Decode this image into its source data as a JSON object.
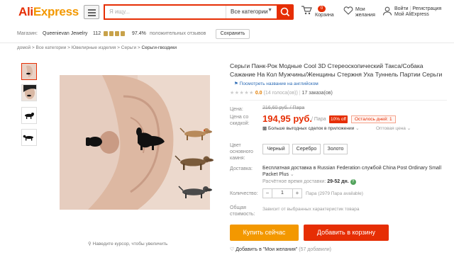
{
  "header": {
    "logo_main": "Ali",
    "logo_accent": "Express",
    "search_placeholder": "Я ищу...",
    "search_category": "Все категории",
    "cart_label": "Корзина",
    "cart_count": "0",
    "wishlist_label_1": "Мои",
    "wishlist_label_2": "желания",
    "signin": "Войти",
    "register": "Регистрация",
    "my_account": "Мой AliExpress"
  },
  "store": {
    "label": "Магазин:",
    "name": "Queenievan Jewelry",
    "score": "112",
    "feedback_percent": "97.4%",
    "feedback_text": "положительных отзывов",
    "subscribe": "Сохранить"
  },
  "breadcrumb": [
    "домой",
    "Все категории",
    "Ювелирные изделия",
    "Серьги",
    "Серьги-гвоздики"
  ],
  "product": {
    "title": "Серьги Панк-Рок Модные Cool 3D Стереоскопический Такса/Собака Сажание На Кол Мужчины/Женщины Стержня Уха Туннель Партии Серьги",
    "translate_link": "Посмотреть название на английском",
    "rating_value": "0.0",
    "votes": "(14 голоса(ов))",
    "orders": "17 заказа(ов)",
    "price_label": "Цена:",
    "old_price": "216,60 руб. / Пара",
    "discount_label_1": "Цена со",
    "discount_label_2": "скидкой:",
    "price": "194,95 руб.",
    "per_unit": "/ Пара",
    "discount_badge": "10% off",
    "days_left": "Осталось дней: 1",
    "deals_text": "Больше выгодных сделок в приложении",
    "wholesale": "Оптовая цена",
    "color_label_1": "Цвет",
    "color_label_2": "основного",
    "color_label_3": "камня:",
    "colors": [
      "Черный",
      "Серебро",
      "Золото"
    ],
    "shipping_label": "Доставка:",
    "shipping_text": "Бесплатная доставка в Russian Federation службой China Post Ordinary Small Packet Plus",
    "ship_time_label": "Расчётное время доставки:",
    "ship_time_value": "29-52 дн.",
    "quantity_label": "Количество:",
    "quantity": "1",
    "available": "Пара (2979 Пара available)",
    "total_label_1": "Общая",
    "total_label_2": "стоимость:",
    "total_note": "Зависит от выбранных характеристик товара",
    "buy_now": "Купить сейчас",
    "add_to_cart": "Добавить в корзину",
    "wishlist_text": "Добавить в \"Мои желания\"",
    "wishlist_count": "(57 добавили)",
    "zoom_hint": "Наведите курсор, чтобы увеличить"
  },
  "colors": {
    "accent": "#e62e04",
    "button_orange": "#f39800",
    "logo_orange": "#f39800"
  }
}
